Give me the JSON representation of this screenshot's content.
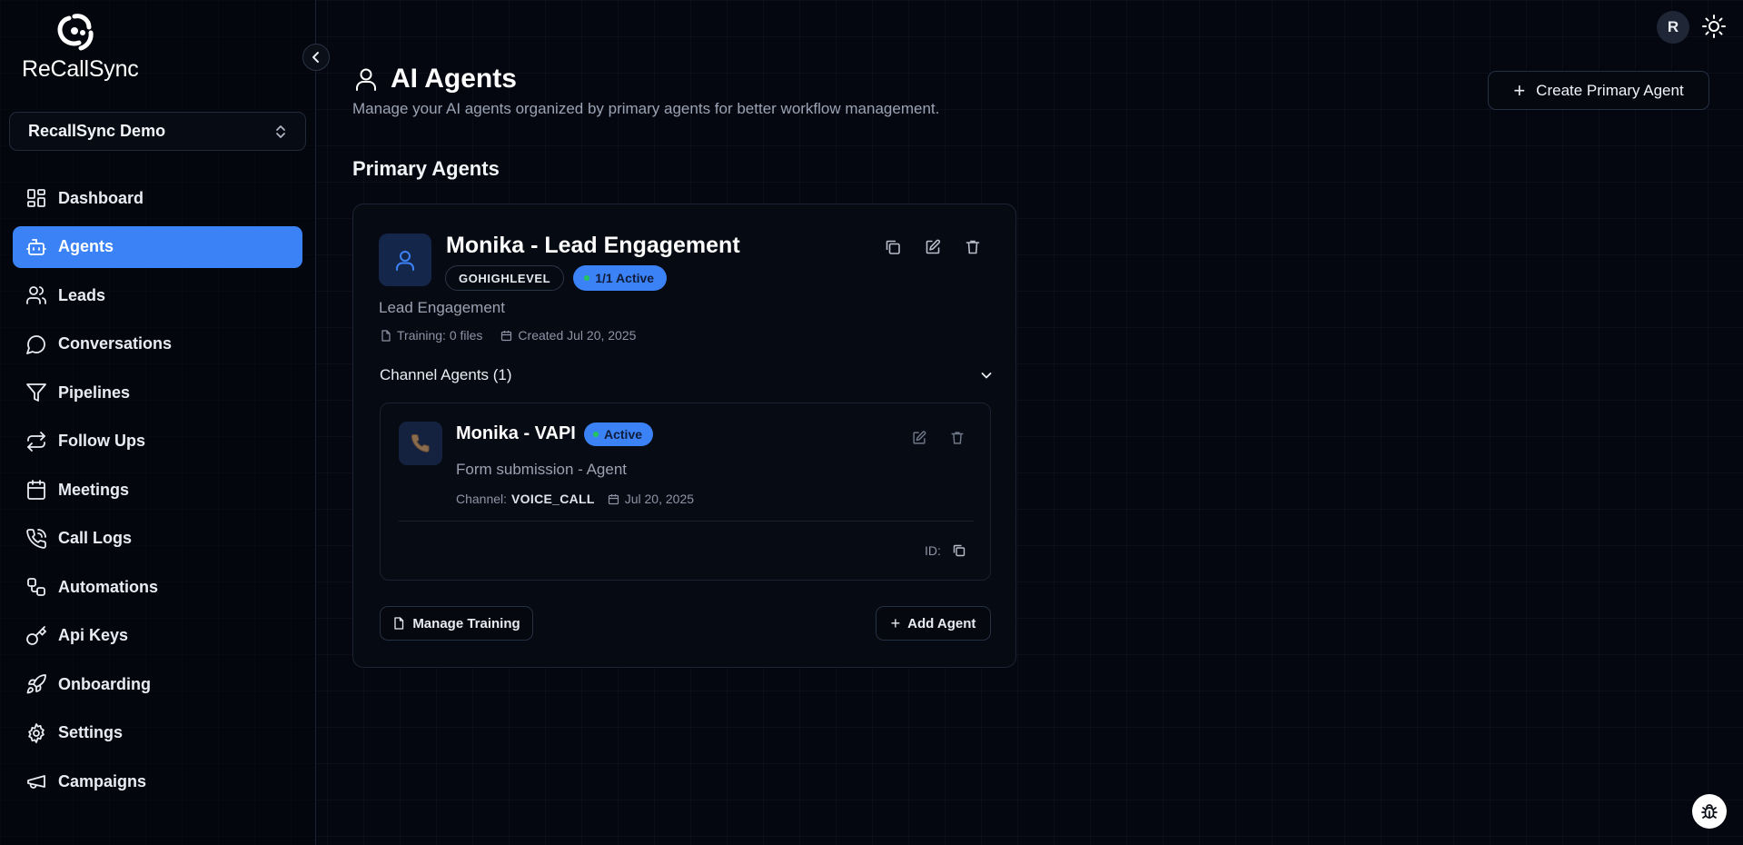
{
  "app": {
    "brand": "ReCallSync"
  },
  "workspace": {
    "label": "RecallSync Demo"
  },
  "sidebar": {
    "items": [
      {
        "label": "Dashboard",
        "icon": "dashboard-icon"
      },
      {
        "label": "Agents",
        "icon": "bot-icon",
        "active": true
      },
      {
        "label": "Leads",
        "icon": "users-icon"
      },
      {
        "label": "Conversations",
        "icon": "chat-icon"
      },
      {
        "label": "Pipelines",
        "icon": "filter-icon"
      },
      {
        "label": "Follow Ups",
        "icon": "repeat-icon"
      },
      {
        "label": "Meetings",
        "icon": "calendar-icon"
      },
      {
        "label": "Call Logs",
        "icon": "phone-call-icon"
      },
      {
        "label": "Automations",
        "icon": "workflow-icon"
      },
      {
        "label": "Api Keys",
        "icon": "key-icon"
      },
      {
        "label": "Onboarding",
        "icon": "rocket-icon"
      },
      {
        "label": "Settings",
        "icon": "gear-icon"
      },
      {
        "label": "Campaigns",
        "icon": "megaphone-icon"
      }
    ]
  },
  "header": {
    "title": "AI Agents",
    "subtitle": "Manage your AI agents organized by primary agents for better workflow management.",
    "create_button": "Create Primary Agent",
    "avatar_initial": "R"
  },
  "section": {
    "title": "Primary Agents"
  },
  "primary_agent": {
    "name": "Monika - Lead Engagement",
    "integration_badge": "GOHIGHLEVEL",
    "status_badge": "1/1 Active",
    "description": "Lead Engagement",
    "training": "Training: 0 files",
    "created": "Created Jul 20, 2025",
    "channel_agents_label": "Channel Agents (1)",
    "manage_training_button": "Manage Training",
    "add_agent_button": "Add Agent"
  },
  "channel_agent": {
    "name": "Monika - VAPI",
    "status": "Active",
    "description": "Form submission - Agent",
    "channel_label": "Channel:",
    "channel_value": "VOICE_CALL",
    "date": "Jul 20, 2025",
    "id_label": "ID:"
  },
  "colors": {
    "background": "#04070f",
    "accent": "#3b82f6",
    "status_dot": "#22c55e"
  }
}
